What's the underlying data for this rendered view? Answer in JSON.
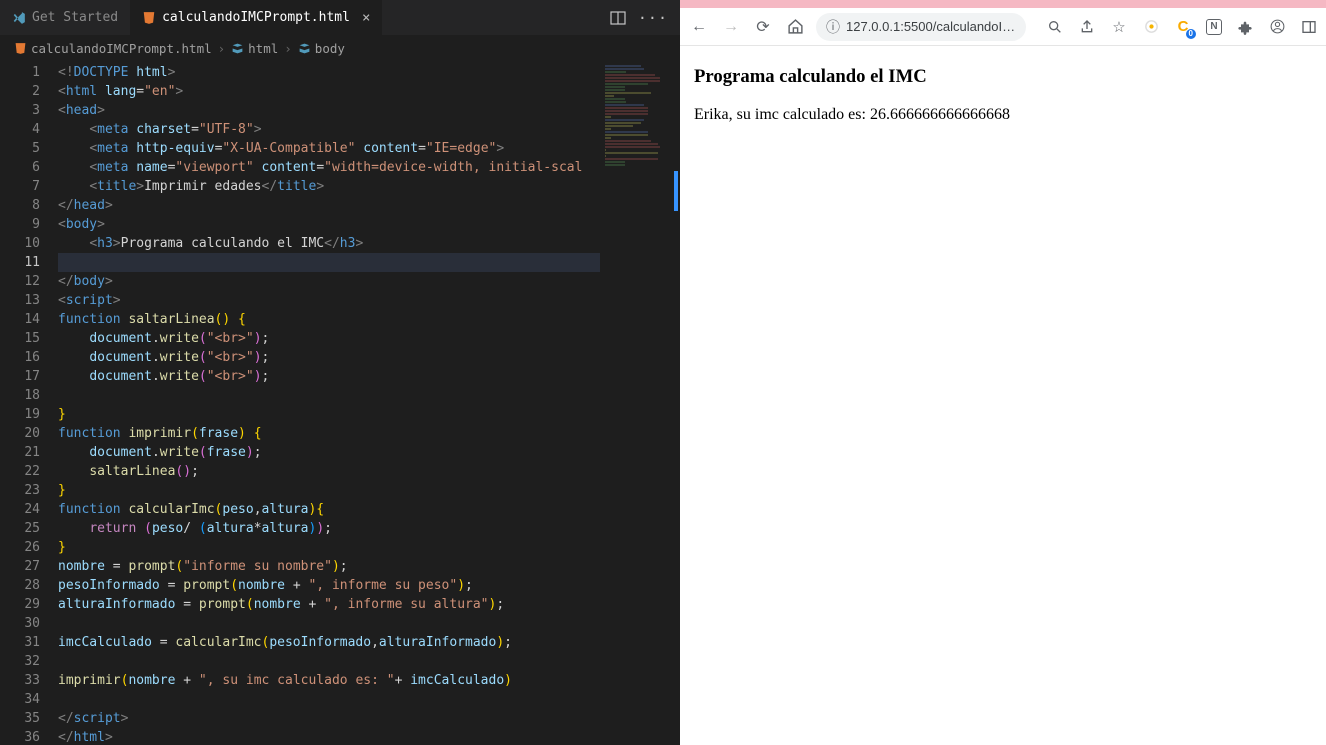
{
  "vscode": {
    "tabs": [
      {
        "label": "Get Started",
        "iconColor": "#519aba"
      },
      {
        "label": "calculandoIMCPrompt.html",
        "iconColor": "#e37933"
      }
    ],
    "breadcrumb": {
      "file": "calculandoIMCPrompt.html",
      "part1": "html",
      "part2": "body"
    },
    "activeLine": 11,
    "lines": [
      "<!DOCTYPE html>",
      "<html lang=\"en\">",
      "<head>",
      "    <meta charset=\"UTF-8\">",
      "    <meta http-equiv=\"X-UA-Compatible\" content=\"IE=edge\">",
      "    <meta name=\"viewport\" content=\"width=device-width, initial-scal",
      "    <title>Imprimir edades</title>",
      "</head>",
      "<body>",
      "    <h3>Programa calculando el IMC</h3>",
      "",
      "</body>",
      "<script>",
      "function saltarLinea() {",
      "    document.write(\"<br>\");",
      "    document.write(\"<br>\");",
      "    document.write(\"<br>\");",
      "",
      "}",
      "function imprimir(frase) {",
      "    document.write(frase);",
      "    saltarLinea();",
      "}",
      "function calcularImc(peso,altura){",
      "    return (peso/ (altura*altura));",
      "}",
      "nombre = prompt(\"informe su nombre\");",
      "pesoInformado = prompt(nombre + \", informe su peso\");",
      "alturaInformado = prompt(nombre + \", informe su altura\");",
      "",
      "imcCalculado = calcularImc(pesoInformado,alturaInformado);",
      "",
      "imprimir(nombre + \", su imc calculado es: \"+ imcCalculado)",
      "",
      "</script>",
      "</html>"
    ]
  },
  "browser": {
    "url": "127.0.0.1:5500/calculandoI…",
    "page": {
      "heading": "Programa calculando el IMC",
      "output": "Erika, su imc calculado es: 26.666666666666668"
    }
  }
}
